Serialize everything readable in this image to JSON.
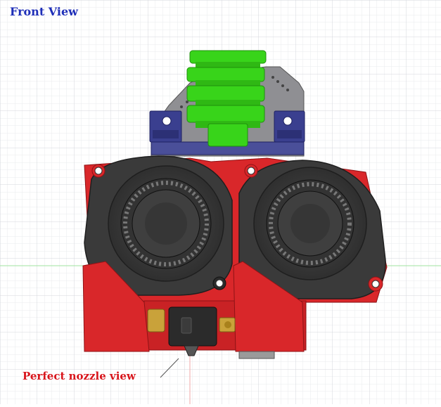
{
  "title": "Front View",
  "caption": "Perfect nozzle view",
  "colors": {
    "background": "#ffffff",
    "grid_minor": "#e9ebee",
    "grid_major": "#d4d7dc",
    "axis_green": "#9fe39f",
    "axis_red": "#f2a8a8",
    "title_text": "#1f2fb8",
    "caption_text": "#d8151b",
    "green_part": "#38d41a",
    "green_dark": "#1f8f0c",
    "red_part": "#d9272a",
    "red_dark": "#8e1316",
    "fan_body": "#3a3a3a",
    "fan_dark": "#1f1f1f",
    "mount_plate": "#8f8f93",
    "bracket_blue": "#3a3f8f",
    "brass": "#c9a23a",
    "heater_block": "#2b2b2b"
  },
  "icons": {
    "main_view": "hotend-assembly-front-view",
    "pointer": "leader-line",
    "fan_left": "blower-fan-left",
    "fan_right": "blower-fan-right",
    "nozzle": "nozzle"
  }
}
